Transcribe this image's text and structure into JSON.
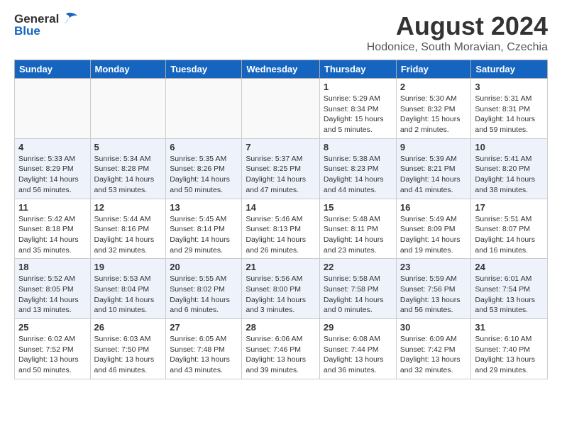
{
  "header": {
    "logo_general": "General",
    "logo_blue": "Blue",
    "title": "August 2024",
    "subtitle": "Hodonice, South Moravian, Czechia"
  },
  "weekdays": [
    "Sunday",
    "Monday",
    "Tuesday",
    "Wednesday",
    "Thursday",
    "Friday",
    "Saturday"
  ],
  "weeks": [
    [
      {
        "day": "",
        "info": ""
      },
      {
        "day": "",
        "info": ""
      },
      {
        "day": "",
        "info": ""
      },
      {
        "day": "",
        "info": ""
      },
      {
        "day": "1",
        "info": "Sunrise: 5:29 AM\nSunset: 8:34 PM\nDaylight: 15 hours\nand 5 minutes."
      },
      {
        "day": "2",
        "info": "Sunrise: 5:30 AM\nSunset: 8:32 PM\nDaylight: 15 hours\nand 2 minutes."
      },
      {
        "day": "3",
        "info": "Sunrise: 5:31 AM\nSunset: 8:31 PM\nDaylight: 14 hours\nand 59 minutes."
      }
    ],
    [
      {
        "day": "4",
        "info": "Sunrise: 5:33 AM\nSunset: 8:29 PM\nDaylight: 14 hours\nand 56 minutes."
      },
      {
        "day": "5",
        "info": "Sunrise: 5:34 AM\nSunset: 8:28 PM\nDaylight: 14 hours\nand 53 minutes."
      },
      {
        "day": "6",
        "info": "Sunrise: 5:35 AM\nSunset: 8:26 PM\nDaylight: 14 hours\nand 50 minutes."
      },
      {
        "day": "7",
        "info": "Sunrise: 5:37 AM\nSunset: 8:25 PM\nDaylight: 14 hours\nand 47 minutes."
      },
      {
        "day": "8",
        "info": "Sunrise: 5:38 AM\nSunset: 8:23 PM\nDaylight: 14 hours\nand 44 minutes."
      },
      {
        "day": "9",
        "info": "Sunrise: 5:39 AM\nSunset: 8:21 PM\nDaylight: 14 hours\nand 41 minutes."
      },
      {
        "day": "10",
        "info": "Sunrise: 5:41 AM\nSunset: 8:20 PM\nDaylight: 14 hours\nand 38 minutes."
      }
    ],
    [
      {
        "day": "11",
        "info": "Sunrise: 5:42 AM\nSunset: 8:18 PM\nDaylight: 14 hours\nand 35 minutes."
      },
      {
        "day": "12",
        "info": "Sunrise: 5:44 AM\nSunset: 8:16 PM\nDaylight: 14 hours\nand 32 minutes."
      },
      {
        "day": "13",
        "info": "Sunrise: 5:45 AM\nSunset: 8:14 PM\nDaylight: 14 hours\nand 29 minutes."
      },
      {
        "day": "14",
        "info": "Sunrise: 5:46 AM\nSunset: 8:13 PM\nDaylight: 14 hours\nand 26 minutes."
      },
      {
        "day": "15",
        "info": "Sunrise: 5:48 AM\nSunset: 8:11 PM\nDaylight: 14 hours\nand 23 minutes."
      },
      {
        "day": "16",
        "info": "Sunrise: 5:49 AM\nSunset: 8:09 PM\nDaylight: 14 hours\nand 19 minutes."
      },
      {
        "day": "17",
        "info": "Sunrise: 5:51 AM\nSunset: 8:07 PM\nDaylight: 14 hours\nand 16 minutes."
      }
    ],
    [
      {
        "day": "18",
        "info": "Sunrise: 5:52 AM\nSunset: 8:05 PM\nDaylight: 14 hours\nand 13 minutes."
      },
      {
        "day": "19",
        "info": "Sunrise: 5:53 AM\nSunset: 8:04 PM\nDaylight: 14 hours\nand 10 minutes."
      },
      {
        "day": "20",
        "info": "Sunrise: 5:55 AM\nSunset: 8:02 PM\nDaylight: 14 hours\nand 6 minutes."
      },
      {
        "day": "21",
        "info": "Sunrise: 5:56 AM\nSunset: 8:00 PM\nDaylight: 14 hours\nand 3 minutes."
      },
      {
        "day": "22",
        "info": "Sunrise: 5:58 AM\nSunset: 7:58 PM\nDaylight: 14 hours\nand 0 minutes."
      },
      {
        "day": "23",
        "info": "Sunrise: 5:59 AM\nSunset: 7:56 PM\nDaylight: 13 hours\nand 56 minutes."
      },
      {
        "day": "24",
        "info": "Sunrise: 6:01 AM\nSunset: 7:54 PM\nDaylight: 13 hours\nand 53 minutes."
      }
    ],
    [
      {
        "day": "25",
        "info": "Sunrise: 6:02 AM\nSunset: 7:52 PM\nDaylight: 13 hours\nand 50 minutes."
      },
      {
        "day": "26",
        "info": "Sunrise: 6:03 AM\nSunset: 7:50 PM\nDaylight: 13 hours\nand 46 minutes."
      },
      {
        "day": "27",
        "info": "Sunrise: 6:05 AM\nSunset: 7:48 PM\nDaylight: 13 hours\nand 43 minutes."
      },
      {
        "day": "28",
        "info": "Sunrise: 6:06 AM\nSunset: 7:46 PM\nDaylight: 13 hours\nand 39 minutes."
      },
      {
        "day": "29",
        "info": "Sunrise: 6:08 AM\nSunset: 7:44 PM\nDaylight: 13 hours\nand 36 minutes."
      },
      {
        "day": "30",
        "info": "Sunrise: 6:09 AM\nSunset: 7:42 PM\nDaylight: 13 hours\nand 32 minutes."
      },
      {
        "day": "31",
        "info": "Sunrise: 6:10 AM\nSunset: 7:40 PM\nDaylight: 13 hours\nand 29 minutes."
      }
    ]
  ]
}
